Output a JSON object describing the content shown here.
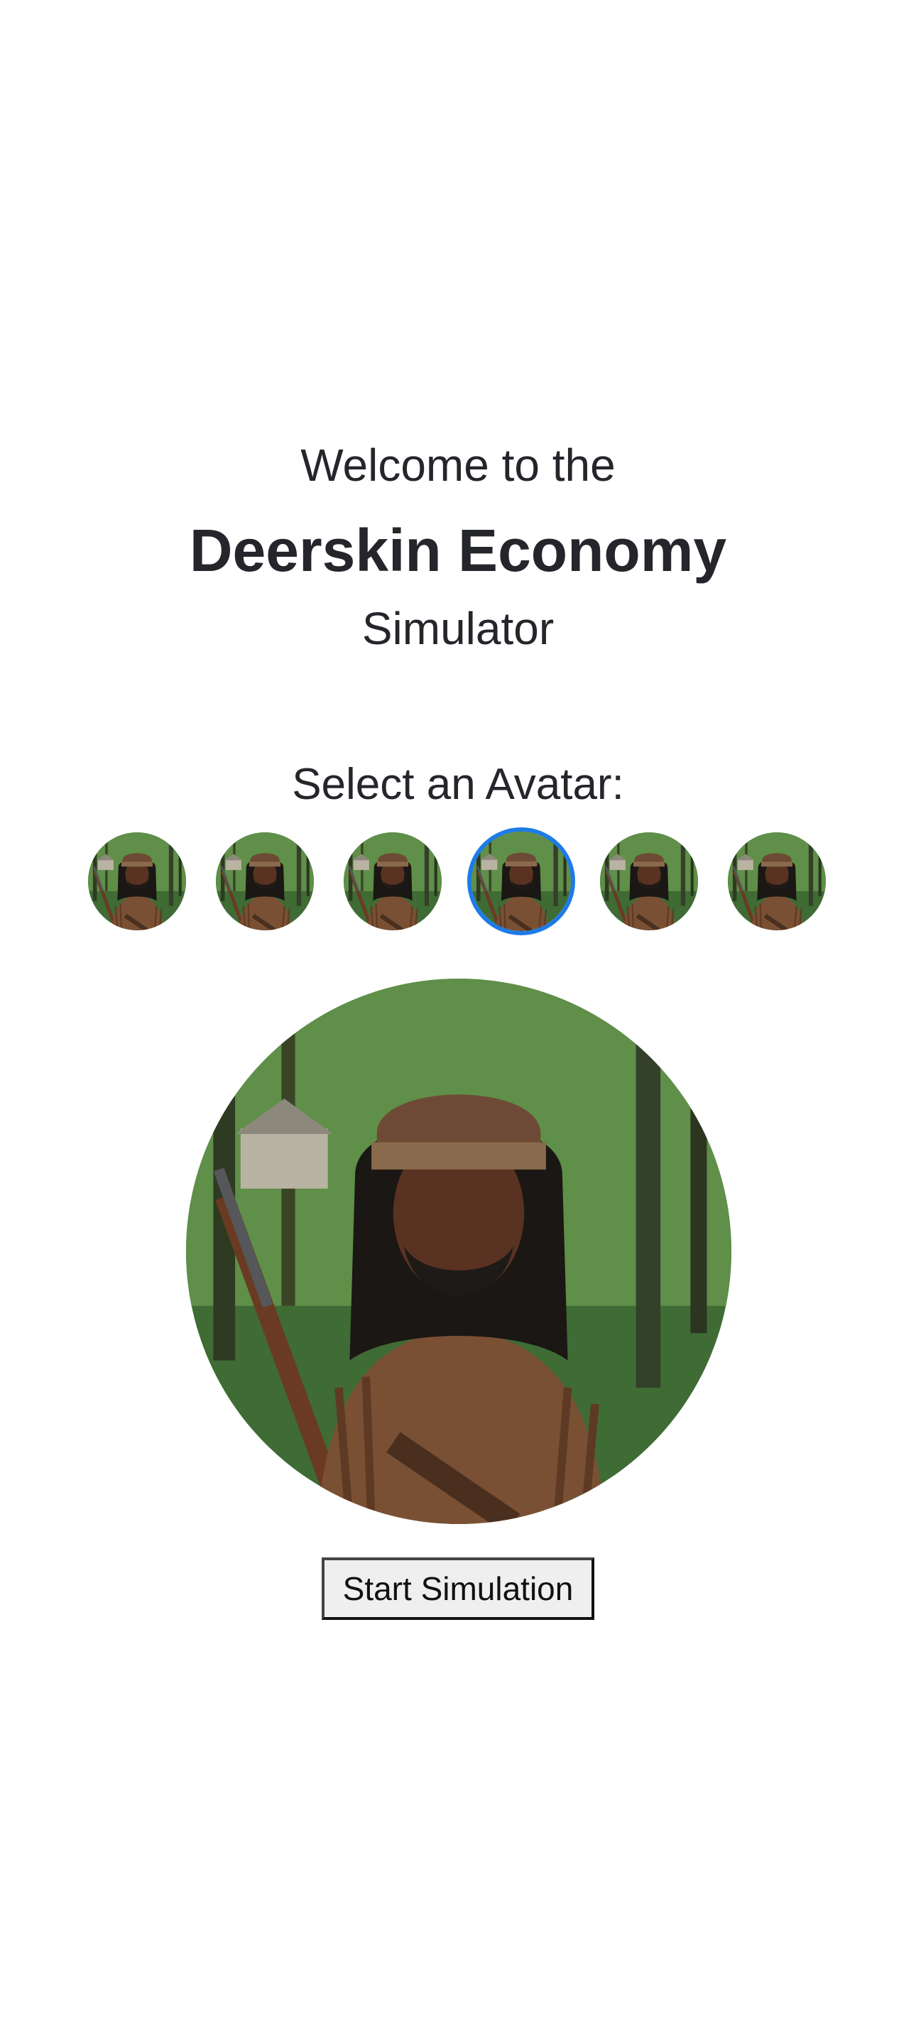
{
  "header": {
    "welcome": "Welcome to the",
    "title": "Deerskin Economy",
    "subtitle": "Simulator"
  },
  "avatar_picker": {
    "label": "Select an Avatar:",
    "selected_index": 3,
    "avatars": [
      {
        "icon": "frontiersman-portrait-icon"
      },
      {
        "icon": "frontiersman-portrait-icon"
      },
      {
        "icon": "frontiersman-portrait-icon"
      },
      {
        "icon": "frontiersman-portrait-icon"
      },
      {
        "icon": "frontiersman-portrait-icon"
      },
      {
        "icon": "frontiersman-portrait-icon"
      }
    ]
  },
  "actions": {
    "start_label": "Start Simulation"
  },
  "colors": {
    "text": "#24262b",
    "selection_ring": "#1e7be6",
    "button_bg": "#efefef"
  }
}
